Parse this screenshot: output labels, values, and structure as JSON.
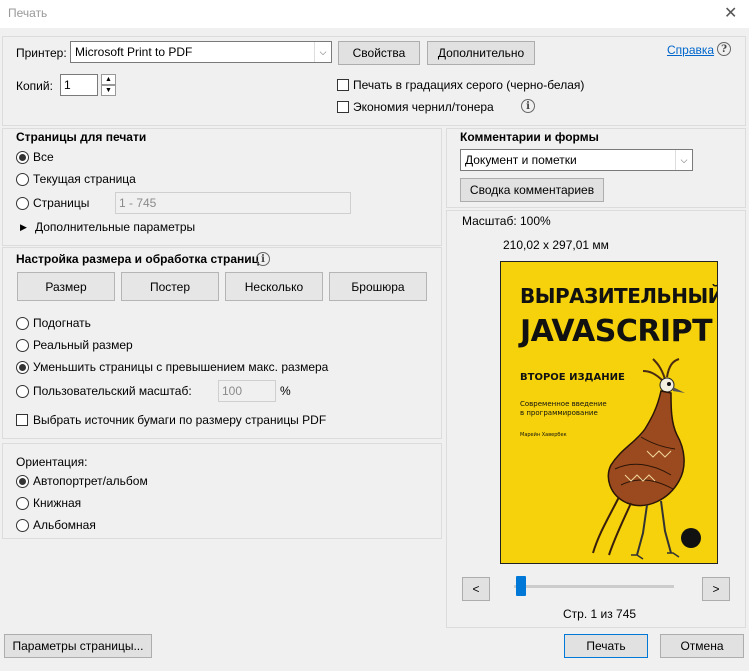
{
  "window": {
    "title": "Печать",
    "close_glyph": "✕"
  },
  "printer": {
    "label": "Принтер:",
    "selected": "Microsoft Print to PDF",
    "properties_button": "Свойства",
    "advanced_button": "Дополнительно",
    "help_link": "Справка"
  },
  "copies": {
    "label": "Копий:",
    "value": "1"
  },
  "options": {
    "grayscale": "Печать в градациях серого (черно-белая)",
    "save_ink": "Экономия чернил/тонера"
  },
  "pages": {
    "heading": "Страницы для печати",
    "all": "Все",
    "current": "Текущая страница",
    "range": "Страницы",
    "range_placeholder": "1 - 745",
    "more": "Дополнительные параметры"
  },
  "sizing": {
    "heading": "Настройка размера и обработка страниц",
    "tabs": [
      "Размер",
      "Постер",
      "Несколько",
      "Брошюра"
    ],
    "fit": "Подогнать",
    "actual": "Реальный размер",
    "shrink": "Уменьшить страницы с превышением макс. размера",
    "custom": "Пользовательский масштаб:",
    "custom_value": "100",
    "percent": "%",
    "paper_source": "Выбрать источник бумаги по размеру страницы PDF"
  },
  "orientation": {
    "heading": "Ориентация:",
    "auto": "Автопортрет/альбом",
    "portrait": "Книжная",
    "landscape": "Альбомная"
  },
  "comments": {
    "heading": "Комментарии и формы",
    "selected": "Документ и пометки",
    "summary_button": "Сводка комментариев"
  },
  "preview": {
    "scale": "Масштаб: 100%",
    "size": "210,02 x 297,01 мм",
    "prev": "<",
    "next": ">",
    "page_indicator": "Стр. 1 из 745",
    "page_fraction": 0.0
  },
  "book": {
    "title_line1": "ВЫРАЗИТЕЛЬНЫЙ",
    "title_line2": "JAVASCRIPT",
    "edition": "ВТОРОЕ ИЗДАНИЕ",
    "subtitle_line1": "Современное введение",
    "subtitle_line2": "в программирование",
    "author": "Марейн Хавербек",
    "background_color": "#f5d20b"
  },
  "footer": {
    "page_setup": "Параметры страницы...",
    "print": "Печать",
    "cancel": "Отмена"
  }
}
